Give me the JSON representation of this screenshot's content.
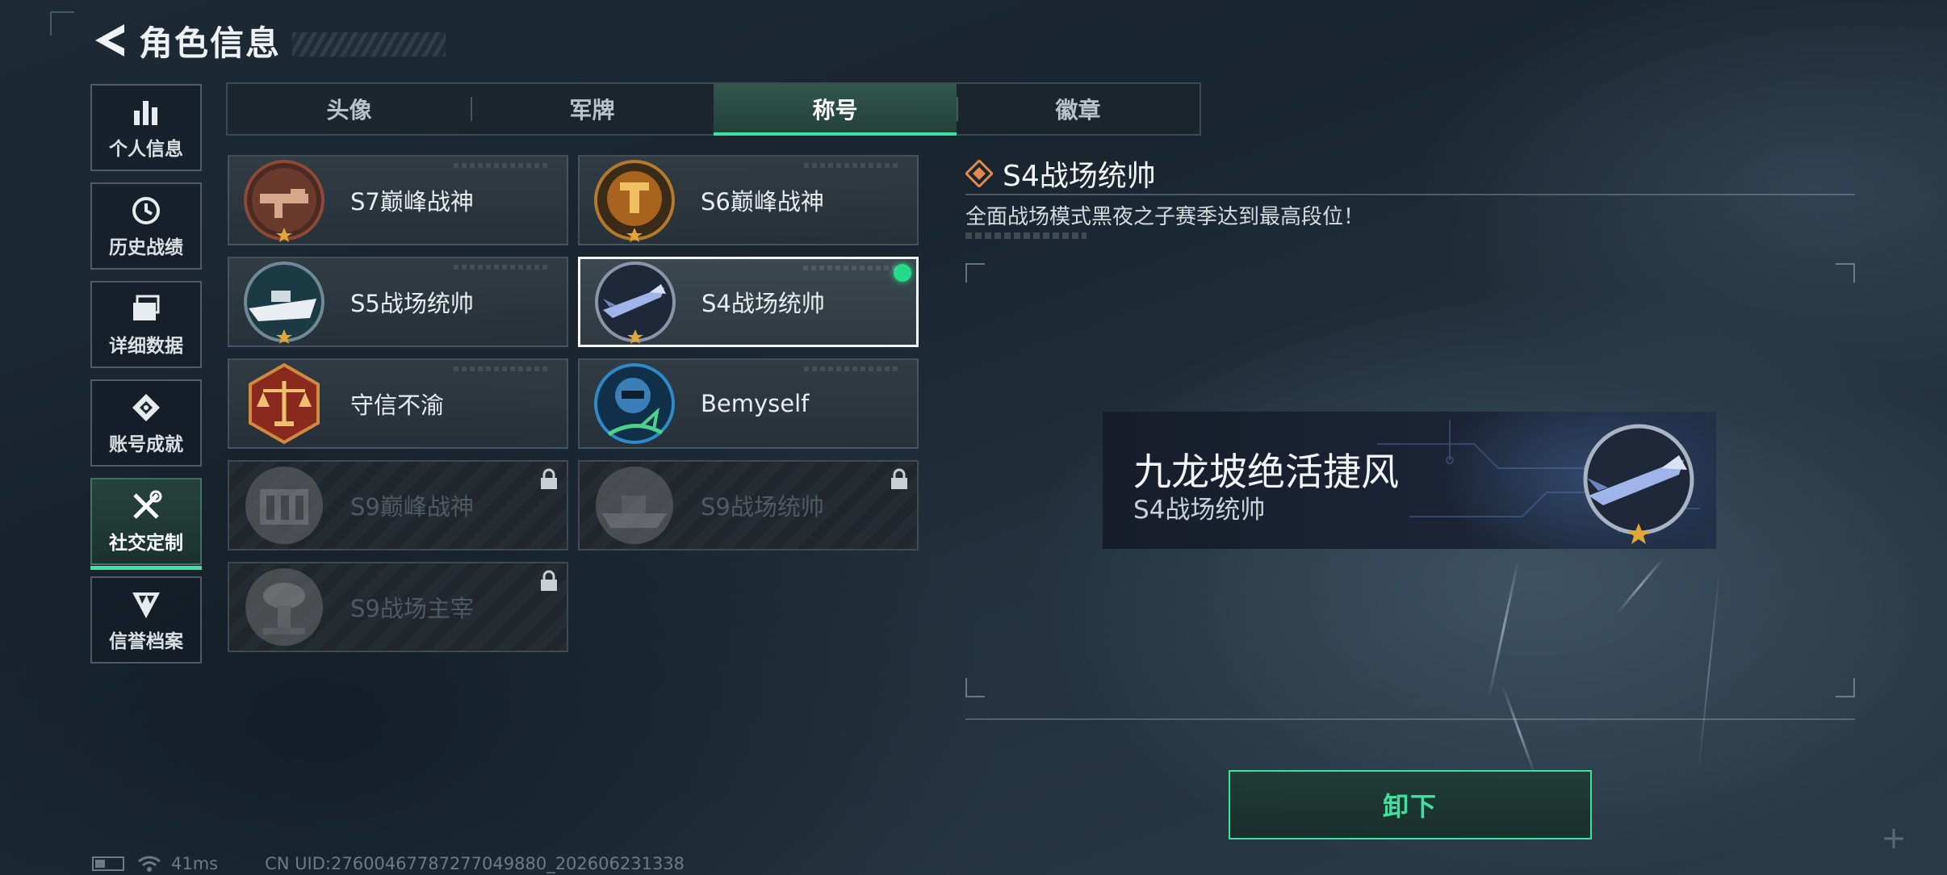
{
  "header": {
    "title": "角色信息"
  },
  "sidebar": {
    "items": [
      {
        "label": "个人信息",
        "icon": "bar-chart-icon"
      },
      {
        "label": "历史战绩",
        "icon": "history-clock-icon"
      },
      {
        "label": "详细数据",
        "icon": "folder-icon"
      },
      {
        "label": "账号成就",
        "icon": "achievement-icon"
      },
      {
        "label": "社交定制",
        "icon": "tools-icon",
        "active": true
      },
      {
        "label": "信誉档案",
        "icon": "credit-shield-icon"
      }
    ]
  },
  "tabs": [
    {
      "label": "头像"
    },
    {
      "label": "军牌"
    },
    {
      "label": "称号",
      "active": true
    },
    {
      "label": "徽章"
    }
  ],
  "titles": [
    {
      "name": "S7巅峰战神",
      "locked": false
    },
    {
      "name": "S6巅峰战神",
      "locked": false
    },
    {
      "name": "S5战场统帅",
      "locked": false
    },
    {
      "name": "S4战场统帅",
      "locked": false,
      "selected": true,
      "equipped": true
    },
    {
      "name": "守信不渝",
      "locked": false
    },
    {
      "name": "Bemyself",
      "locked": false
    },
    {
      "name": "S9巅峰战神",
      "locked": true
    },
    {
      "name": "S9战场统帅",
      "locked": true
    },
    {
      "name": "S9战场主宰",
      "locked": true
    }
  ],
  "detail": {
    "title": "S4战场统帅",
    "description": "全面战场模式黑夜之子赛季达到最高段位！"
  },
  "banner": {
    "player_name": "九龙坡绝活捷风",
    "title": "S4战场统帅"
  },
  "actions": {
    "unequip_label": "卸下"
  },
  "status": {
    "ping": "41ms",
    "uid": "CN UID:27600467787277049880_202606231338"
  },
  "colors": {
    "accent": "#3ee2a0",
    "equipped": "#27d98a",
    "gold": "#e0a638"
  }
}
